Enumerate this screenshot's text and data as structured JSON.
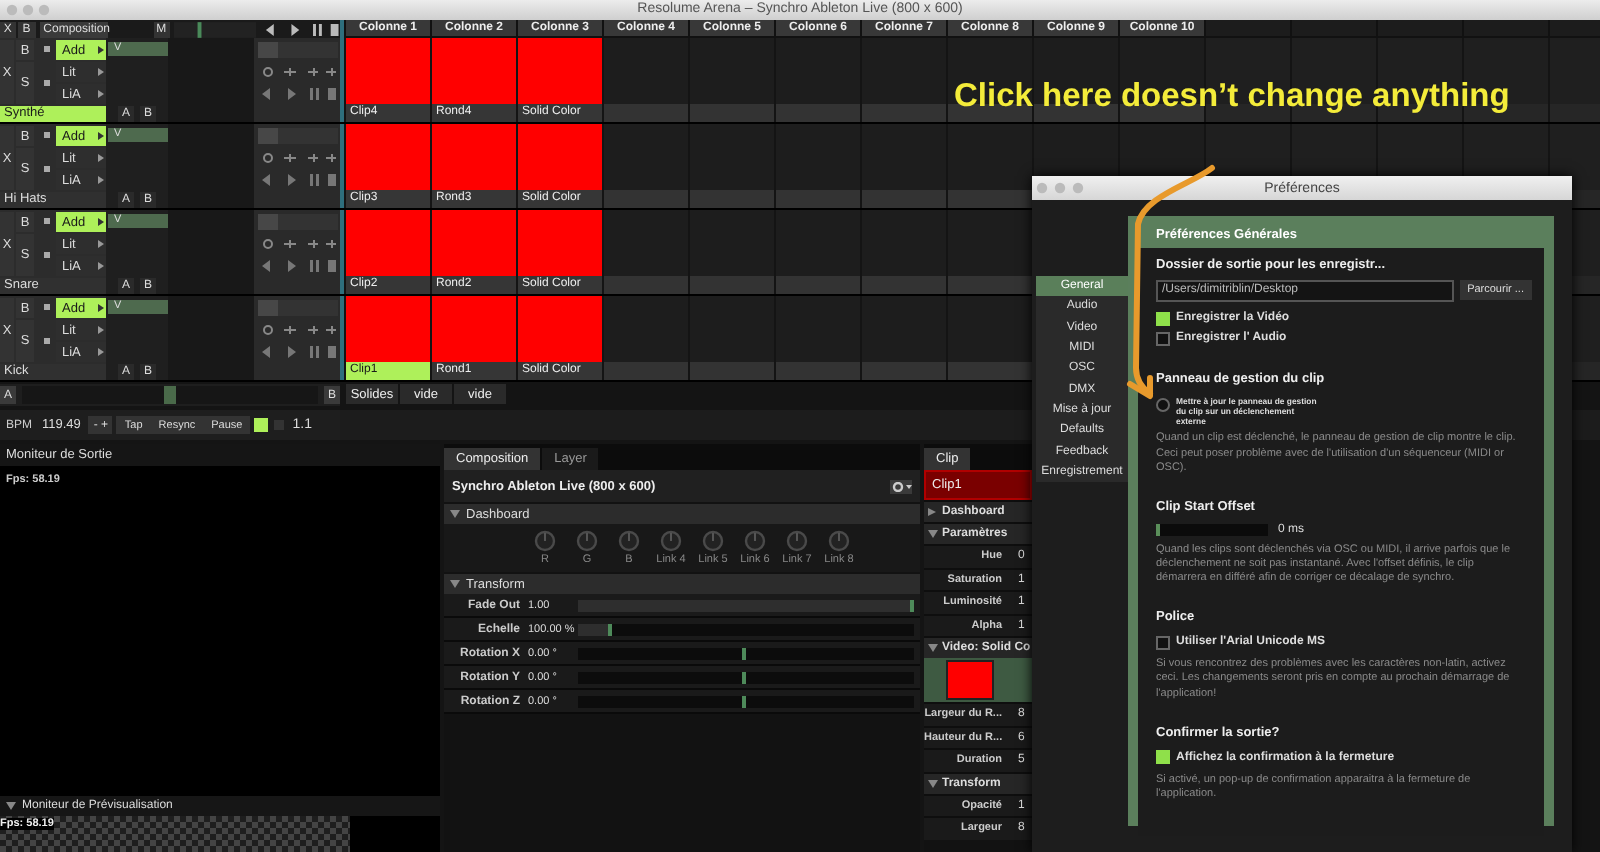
{
  "window": {
    "title": "Resolume Arena – Synchro Ableton Live (800 x 600)"
  },
  "layer_header": {
    "bypass": "X",
    "blend": "B",
    "label": "Composition",
    "master": "M"
  },
  "columns": [
    "Colonne 1",
    "Colonne 2",
    "Colonne 3",
    "Colonne 4",
    "Colonne 5",
    "Colonne 6",
    "Colonne 7",
    "Colonne 8",
    "Colonne 9",
    "Colonne 10"
  ],
  "layers": [
    {
      "bypass": "X",
      "b": "B",
      "solo": "S",
      "blend_modes": [
        {
          "label": "Add",
          "selected": true
        },
        {
          "label": "Lit",
          "selected": false
        },
        {
          "label": "LiA",
          "selected": false
        }
      ],
      "mask": "V",
      "name": "Synthé",
      "selected": true,
      "a": "A",
      "b_out": "B",
      "clips": [
        {
          "label": "Clip4",
          "selected": false
        },
        {
          "label": "Rond4",
          "selected": false
        },
        {
          "label": "Solid Color",
          "selected": false
        }
      ]
    },
    {
      "bypass": "X",
      "b": "B",
      "solo": "S",
      "blend_modes": [
        {
          "label": "Add",
          "selected": true
        },
        {
          "label": "Lit",
          "selected": false
        },
        {
          "label": "LiA",
          "selected": false
        }
      ],
      "mask": "V",
      "name": "Hi Hats",
      "selected": false,
      "a": "A",
      "b_out": "B",
      "clips": [
        {
          "label": "Clip3",
          "selected": false
        },
        {
          "label": "Rond3",
          "selected": false
        },
        {
          "label": "Solid Color",
          "selected": false
        }
      ]
    },
    {
      "bypass": "X",
      "b": "B",
      "solo": "S",
      "blend_modes": [
        {
          "label": "Add",
          "selected": true
        },
        {
          "label": "Lit",
          "selected": false
        },
        {
          "label": "LiA",
          "selected": false
        }
      ],
      "mask": "V",
      "name": "Snare",
      "selected": false,
      "a": "A",
      "b_out": "B",
      "clips": [
        {
          "label": "Clip2",
          "selected": false
        },
        {
          "label": "Rond2",
          "selected": false
        },
        {
          "label": "Solid Color",
          "selected": false
        }
      ]
    },
    {
      "bypass": "X",
      "b": "B",
      "solo": "S",
      "blend_modes": [
        {
          "label": "Add",
          "selected": true
        },
        {
          "label": "Lit",
          "selected": false
        },
        {
          "label": "LiA",
          "selected": false
        }
      ],
      "mask": "V",
      "name": "Kick",
      "selected": false,
      "a": "A",
      "b_out": "B",
      "clips": [
        {
          "label": "Clip1",
          "selected": true
        },
        {
          "label": "Rond1",
          "selected": false
        },
        {
          "label": "Solid Color",
          "selected": false
        }
      ]
    }
  ],
  "crossfader": {
    "a": "A",
    "b": "B",
    "level": 0.5
  },
  "decks": [
    "Solides",
    "vide",
    "vide"
  ],
  "transport": {
    "bpm_label": "BPM",
    "bpm": "119.49",
    "nudge": "- +",
    "buttons": [
      "Tap",
      "Resync",
      "Pause"
    ],
    "metronome_on": true,
    "beat": "1.1"
  },
  "output_monitor": {
    "title": "Moniteur de Sortie",
    "fps": "Fps: 58.19"
  },
  "preview_monitor": {
    "title": "Moniteur de Prévisualisation",
    "fps": "Fps: 58.19"
  },
  "composition_panel": {
    "tabs": [
      {
        "label": "Composition",
        "selected": true
      },
      {
        "label": "Layer",
        "selected": false
      }
    ],
    "title": "Synchro Ableton Live (800 x 600)",
    "dashboard": {
      "label": "Dashboard",
      "expanded": true,
      "knobs": [
        "R",
        "G",
        "B",
        "Link 4",
        "Link 5",
        "Link 6",
        "Link 7",
        "Link 8"
      ]
    },
    "transform": {
      "label": "Transform",
      "expanded": true,
      "params": [
        {
          "label": "Fade Out",
          "value": "1.00",
          "kind": "fill",
          "level": 1.0
        },
        {
          "label": "Echelle",
          "value": "100.00 %",
          "kind": "fill",
          "level": 0.1
        },
        {
          "label": "Rotation X",
          "value": "0.00 °",
          "kind": "centered",
          "level": 0.5
        },
        {
          "label": "Rotation Y",
          "value": "0.00 °",
          "kind": "centered",
          "level": 0.5
        },
        {
          "label": "Rotation Z",
          "value": "0.00 °",
          "kind": "centered",
          "level": 0.5
        }
      ]
    }
  },
  "clip_panel": {
    "tab": "Clip",
    "name": "Clip1",
    "items": [
      {
        "kind": "section",
        "label": "Dashboard",
        "expanded": false
      },
      {
        "kind": "section",
        "label": "Paramètres",
        "expanded": true
      },
      {
        "kind": "param",
        "label": "Hue",
        "value": "0"
      },
      {
        "kind": "param",
        "label": "Saturation",
        "value": "1"
      },
      {
        "kind": "param",
        "label": "Luminosité",
        "value": "1"
      },
      {
        "kind": "param",
        "label": "Alpha",
        "value": "1"
      },
      {
        "kind": "section",
        "label": "Video: Solid Co",
        "expanded": true
      },
      {
        "kind": "thumbnail"
      },
      {
        "kind": "param",
        "label": "Largeur du R...",
        "value": "8"
      },
      {
        "kind": "param",
        "label": "Hauteur du R...",
        "value": "6"
      },
      {
        "kind": "param",
        "label": "Duration",
        "value": "5"
      },
      {
        "kind": "section",
        "label": "Transform",
        "expanded": true
      },
      {
        "kind": "param",
        "label": "Opacité",
        "value": "1"
      },
      {
        "kind": "param",
        "label": "Largeur",
        "value": "8"
      }
    ]
  },
  "preferences": {
    "title": "Préférences",
    "categories": [
      {
        "label": "General",
        "selected": true
      },
      {
        "label": "Audio",
        "selected": false
      },
      {
        "label": "Video",
        "selected": false
      },
      {
        "label": "MIDI",
        "selected": false
      },
      {
        "label": "OSC",
        "selected": false
      },
      {
        "label": "DMX",
        "selected": false
      },
      {
        "label": "Mise à jour",
        "selected": false
      },
      {
        "label": "Defaults",
        "selected": false
      },
      {
        "label": "Feedback",
        "selected": false
      },
      {
        "label": "Enregistrement",
        "selected": false
      }
    ],
    "heading": "Préférences Générales",
    "sections": [
      {
        "title": "Dossier de sortie pour les enregistr...",
        "controls": [
          {
            "kind": "path",
            "value": "/Users/dimitriblin/Desktop",
            "button": "Parcourir ..."
          },
          {
            "kind": "checkbox",
            "label": "Enregistrer la Vidéo",
            "checked": true
          },
          {
            "kind": "checkbox",
            "label": "Enregistrer l' Audio",
            "checked": false
          }
        ]
      },
      {
        "title": "Panneau de gestion du clip",
        "controls": [
          {
            "kind": "smallcheck",
            "label": "Mettre à jour le panneau de gestion du clip sur un déclenchement externe",
            "checked": false
          }
        ],
        "note": "Quand un clip est déclenché, le panneau de gestion de clip montre le clip. Ceci peut poser problème avec de l'utilisation d'un séquenceur (MIDI or OSC)."
      },
      {
        "title": "Clip Start Offset",
        "controls": [
          {
            "kind": "slider",
            "level": 0.03,
            "value": "0 ms"
          }
        ],
        "note": "Quand les clips sont déclenchés via OSC ou MIDI, il arrive parfois que le déclenchement ne soit pas instantané. Avec l'offset définis, le clip démarrera en différé afin de corriger ce décalage de synchro."
      },
      {
        "title": "Police",
        "controls": [
          {
            "kind": "checkbox",
            "label": "Utiliser l'Arial Unicode MS",
            "checked": false
          }
        ],
        "note": "Si vous rencontrez des problèmes avec les caractères non-latin, activez ceci. Les changements seront pris en compte au prochain démarrage de l'application!"
      },
      {
        "title": "Confirmer la sortie?",
        "controls": [
          {
            "kind": "checkbox",
            "label": "Affichez la confirmation à la fermeture",
            "checked": true
          }
        ],
        "note": "Si activé, un pop-up de confirmation apparaitra à la fermeture de l'application."
      }
    ]
  },
  "annotation": {
    "text": "Click here doesn’t change anything"
  }
}
